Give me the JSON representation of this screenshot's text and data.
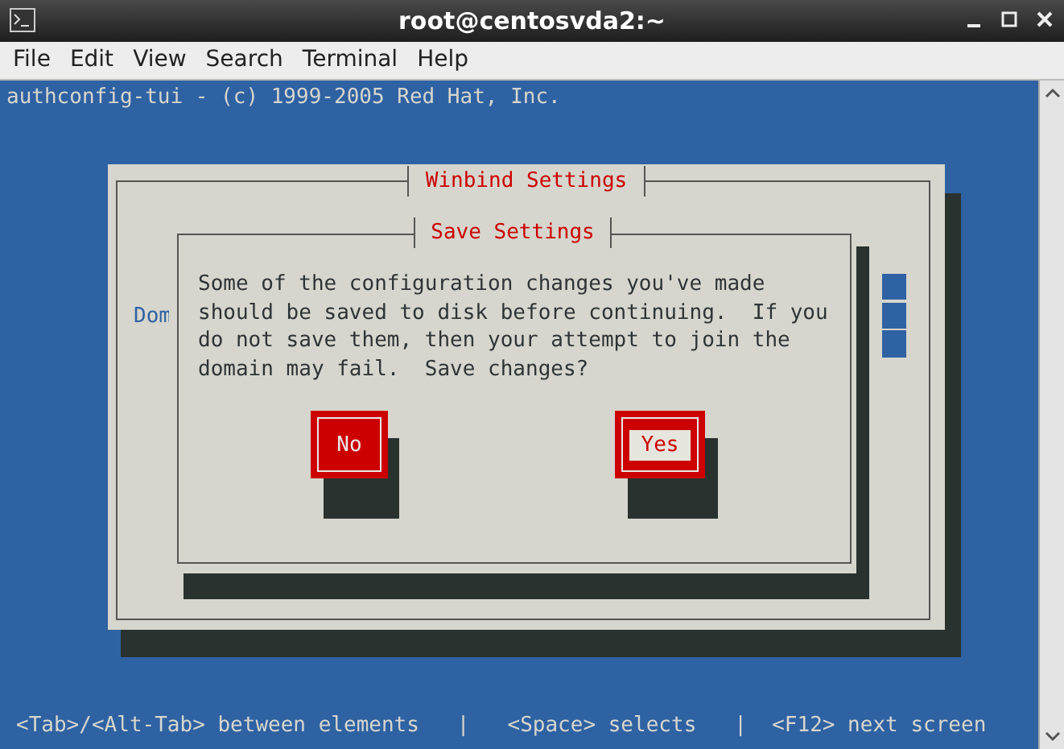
{
  "window": {
    "title": "root@centosvda2:~"
  },
  "menu": [
    "File",
    "Edit",
    "View",
    "Search",
    "Terminal",
    "Help"
  ],
  "terminal": {
    "header": "authconfig-tui - (c) 1999-2005 Red Hat, Inc.",
    "status_line": "<Tab>/<Alt-Tab> between elements   |   <Space> selects   |  <F12> next screen"
  },
  "outer_dialog": {
    "title": "Winbind Settings",
    "label": "Dom"
  },
  "save_dialog": {
    "title": "Save Settings",
    "message": [
      "Some of the configuration changes you've made",
      "should be saved to disk before continuing.  If you",
      "do not save them, then your attempt to join the",
      "domain may fail.  Save changes?"
    ],
    "buttons": [
      {
        "label": "No",
        "selected": false
      },
      {
        "label": "Yes",
        "selected": true
      }
    ]
  }
}
